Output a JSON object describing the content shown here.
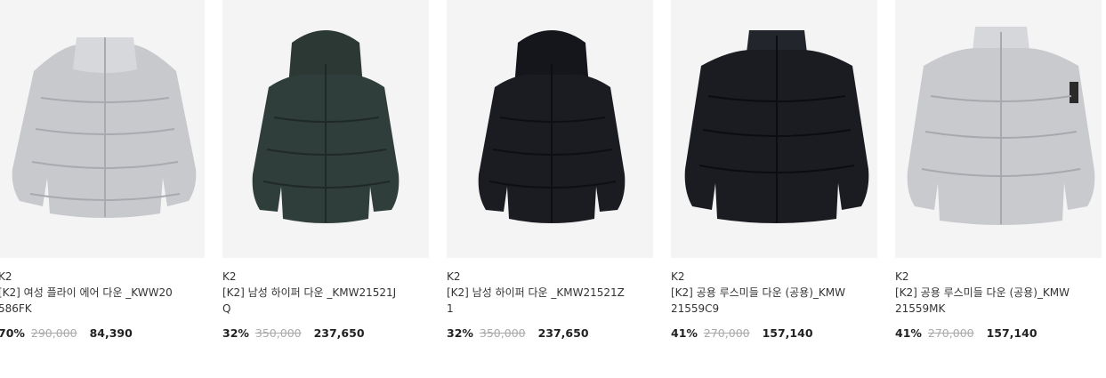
{
  "products": [
    {
      "brand": "K2",
      "title": "[K2] 여성 플라이 에어 다운 _KWW20586FK",
      "discount": "70%",
      "original_price": "290,000",
      "sale_price": "84,390",
      "image_icon": "jacket-image",
      "color": "#c8c9cd"
    },
    {
      "brand": "K2",
      "title": "[K2] 남성 하이퍼 다운 _KMW21521JQ",
      "discount": "32%",
      "original_price": "350,000",
      "sale_price": "237,650",
      "image_icon": "hooded-jacket-image",
      "color": "#2f3e3a"
    },
    {
      "brand": "K2",
      "title": "[K2] 남성 하이퍼 다운 _KMW21521Z1",
      "discount": "32%",
      "original_price": "350,000",
      "sale_price": "237,650",
      "image_icon": "hooded-jacket-image",
      "color": "#1b1c22"
    },
    {
      "brand": "K2",
      "title": "[K2] 공용 루스미들 다운 (공용)_KMW21559C9",
      "discount": "41%",
      "original_price": "270,000",
      "sale_price": "157,140",
      "image_icon": "jacket-image",
      "color": "#1a1c22"
    },
    {
      "brand": "K2",
      "title": "[K2] 공용 루스미들 다운 (공용)_KMW21559MK",
      "discount": "41%",
      "original_price": "270,000",
      "sale_price": "157,140",
      "image_icon": "jacket-image",
      "color": "#c9cacd"
    }
  ]
}
